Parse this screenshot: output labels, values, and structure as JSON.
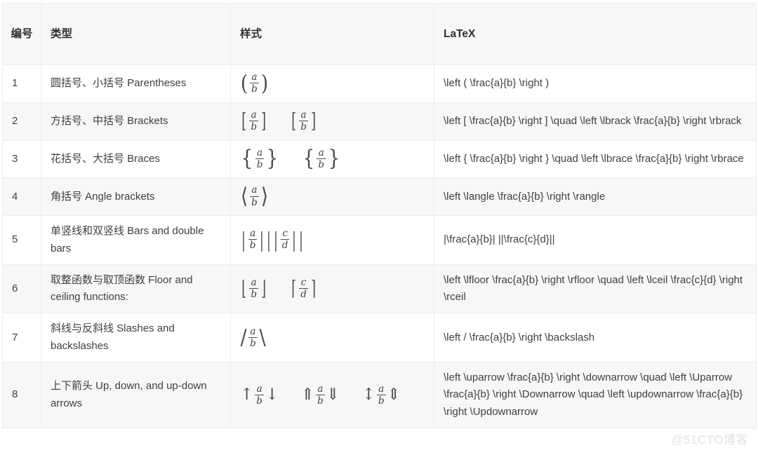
{
  "table": {
    "headers": {
      "num": "编号",
      "type": "类型",
      "style": "样式",
      "latex": "LaTeX"
    },
    "rows": [
      {
        "num": "1",
        "type": "圆括号、小括号 Parentheses",
        "style_text": "(a/b)",
        "latex": "\\left ( \\frac{a}{b} \\right )"
      },
      {
        "num": "2",
        "type": "方括号、中括号 Brackets",
        "style_text": "[a/b]   [a/b]",
        "latex": "\\left [ \\frac{a}{b} \\right ] \\quad \\left \\lbrack \\frac{a}{b} \\right \\rbrack"
      },
      {
        "num": "3",
        "type": "花括号、大括号 Braces",
        "style_text": "{a/b}   {a/b}",
        "latex": "\\left { \\frac{a}{b} \\right } \\quad \\left \\lbrace \\frac{a}{b} \\right \\rbrace"
      },
      {
        "num": "4",
        "type": "角括号 Angle brackets",
        "style_text": "⟨a/b⟩",
        "latex": "\\left \\langle \\frac{a}{b} \\right \\rangle"
      },
      {
        "num": "5",
        "type": "单竖线和双竖线 Bars and double bars",
        "style_text": "|a/b| ||c/d||",
        "latex": "|\\frac{a}{b}|   ||\\frac{c}{d}||"
      },
      {
        "num": "6",
        "type": "取整函数与取顶函数 Floor and ceiling functions:",
        "style_text": "⌊a/b⌋   ⌈c/d⌉",
        "latex": "\\left \\lfloor \\frac{a}{b} \\right \\rfloor \\quad \\left \\lceil \\frac{c}{d} \\right \\rceil"
      },
      {
        "num": "7",
        "type": "斜线与反斜线 Slashes and backslashes",
        "style_text": "/a/b\\",
        "latex": "\\left / \\frac{a}{b} \\right \\backslash"
      },
      {
        "num": "8",
        "type": "上下箭头 Up, down, and up-down arrows",
        "style_text": "↑a/b↓  ⇑a/b⇓  ↕a/b⇕",
        "latex": "\\left \\uparrow \\frac{a}{b} \\right \\downarrow \\quad \\left \\Uparrow \\frac{a}{b} \\right \\Downarrow \\quad \\left \\updownarrow \\frac{a}{b} \\right \\Updownarrow"
      }
    ],
    "fraction_vars": {
      "ab": {
        "numer": "a",
        "denom": "b"
      },
      "cd": {
        "numer": "c",
        "denom": "d"
      }
    },
    "delimiters": {
      "paren_left": "(",
      "paren_right": ")",
      "bracket_left": "[",
      "bracket_right": "]",
      "brace_left": "{",
      "brace_right": "}",
      "angle_left": "⟨",
      "angle_right": "⟩",
      "bar": "|",
      "floor_left": "⌊",
      "floor_right": "⌋",
      "ceil_left": "⌈",
      "ceil_right": "⌉",
      "slash": "/",
      "backslash": "\\",
      "uparrow": "↑",
      "downarrow": "↓",
      "Uparrow": "⇑",
      "Downarrow": "⇓",
      "updownarrow": "↕",
      "Updownarrow": "⇕"
    }
  },
  "watermark": "@51CTO博客",
  "colors": {
    "header_bg": "#f7f7f8",
    "row_alt_bg": "#f7f7f8",
    "border": "#eaecef",
    "text": "#3f3f3f",
    "watermark": "#e2e2e2"
  }
}
